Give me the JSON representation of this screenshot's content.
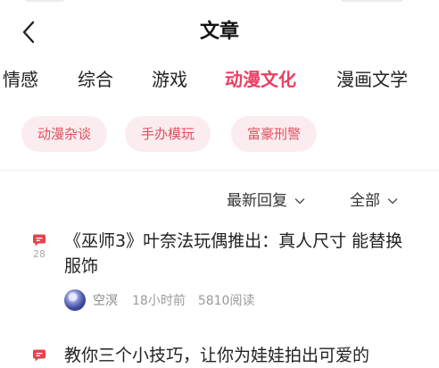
{
  "header": {
    "title": "文章"
  },
  "tabs": [
    {
      "label": "情感",
      "active": false
    },
    {
      "label": "综合",
      "active": false
    },
    {
      "label": "游戏",
      "active": false
    },
    {
      "label": "动漫文化",
      "active": true
    },
    {
      "label": "漫画文学",
      "active": false
    }
  ],
  "tags": [
    {
      "label": "动漫杂谈"
    },
    {
      "label": "手办模玩"
    },
    {
      "label": "富豪刑警"
    }
  ],
  "filters": {
    "sort_label": "最新回复",
    "scope_label": "全部"
  },
  "articles": [
    {
      "reply_count": "28",
      "title": "《巫师3》叶奈法玩偶推出：真人尺寸 能替换服饰",
      "author": "空溟",
      "time": "18小时前",
      "reads": "5810阅读"
    },
    {
      "reply_count": "",
      "title": "教你三个小技巧，让你为娃娃拍出可爱的"
    }
  ],
  "colors": {
    "accent": "#ea3f63",
    "tag_bg": "#fbecef",
    "tag_text": "#e2505e",
    "reply_icon": "#e8424e"
  },
  "icons": {
    "back": "chevron-left-icon",
    "reply": "comment-bubble-icon",
    "dropdown": "chevron-down-icon"
  }
}
